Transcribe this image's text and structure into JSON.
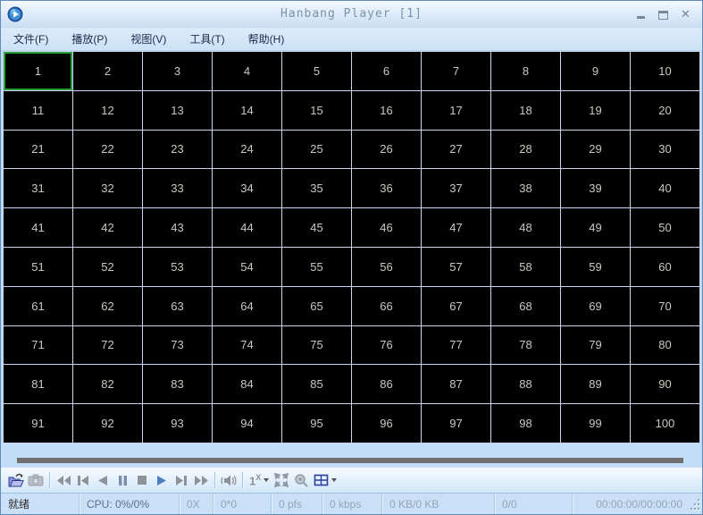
{
  "window": {
    "title": "Hanbang Player [1]"
  },
  "menu": {
    "items": [
      {
        "id": "file",
        "label": "文件(F)"
      },
      {
        "id": "play",
        "label": "播放(P)"
      },
      {
        "id": "view",
        "label": "视图(V)"
      },
      {
        "id": "tools",
        "label": "工具(T)"
      },
      {
        "id": "help",
        "label": "帮助(H)"
      }
    ]
  },
  "grid": {
    "rows": 10,
    "cols": 10,
    "selected": 1,
    "cells": [
      1,
      2,
      3,
      4,
      5,
      6,
      7,
      8,
      9,
      10,
      11,
      12,
      13,
      14,
      15,
      16,
      17,
      18,
      19,
      20,
      21,
      22,
      23,
      24,
      25,
      26,
      27,
      28,
      29,
      30,
      31,
      32,
      33,
      34,
      35,
      36,
      37,
      38,
      39,
      40,
      41,
      42,
      43,
      44,
      45,
      46,
      47,
      48,
      49,
      50,
      51,
      52,
      53,
      54,
      55,
      56,
      57,
      58,
      59,
      60,
      61,
      62,
      63,
      64,
      65,
      66,
      67,
      68,
      69,
      70,
      71,
      72,
      73,
      74,
      75,
      76,
      77,
      78,
      79,
      80,
      81,
      82,
      83,
      84,
      85,
      86,
      87,
      88,
      89,
      90,
      91,
      92,
      93,
      94,
      95,
      96,
      97,
      98,
      99,
      100
    ]
  },
  "toolbar": {
    "speed_label_base": "1",
    "speed_label_sup": "X"
  },
  "statusbar": {
    "segments": [
      "就绪",
      "CPU: 0%/0%",
      "0X",
      "0*0",
      "0 pfs",
      "0 kbps",
      "0 KB/0 KB",
      "0/0",
      "00:00:00/00:00:00"
    ]
  },
  "colors": {
    "selected_cell_border": "#2ba13c",
    "grid_line": "#ccd4f4",
    "cell_background": "#000000",
    "seekbar": "#707070",
    "play_icon": "#4e7fc1",
    "titlebar_text": "#7b93ab"
  }
}
